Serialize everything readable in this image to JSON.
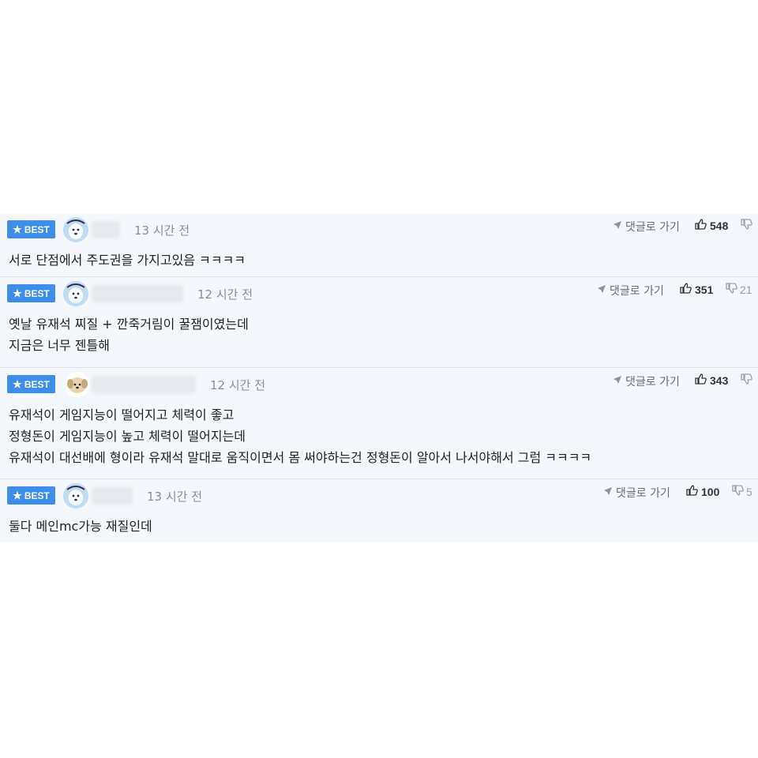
{
  "badge_label": "BEST",
  "reply_label": "댓글로 가기",
  "comments": [
    {
      "time": "13 시간 전",
      "likes": "548",
      "dislikes": "",
      "lines": [
        "서로 단점에서 주도권을 가지고있음 ㅋㅋㅋㅋ"
      ]
    },
    {
      "time": "12 시간 전",
      "likes": "351",
      "dislikes": "21",
      "lines": [
        "옛날 유재석 찌질 + 깐죽거림이 꿀잼이였는데",
        "지금은 너무 젠틀해"
      ]
    },
    {
      "time": "12 시간 전",
      "likes": "343",
      "dislikes": "",
      "lines": [
        "유재석이 게임지능이 떨어지고 체력이 좋고",
        "정형돈이 게임지능이 높고 체력이 떨어지는데",
        "유재석이 대선배에 형이라 유재석 말대로 움직이면서 몸 써야하는건 정형돈이 알아서 나서야해서 그럼 ㅋㅋㅋㅋ"
      ]
    },
    {
      "time": "13 시간 전",
      "likes": "100",
      "dislikes": "5",
      "lines": [
        "둘다 메인mc가능 재질인데"
      ]
    }
  ],
  "icons": {
    "badge": "star-icon",
    "reply": "arrow-icon",
    "like": "thumbs-up-icon",
    "dislike": "thumbs-down-icon"
  },
  "colors": {
    "badge_bg": "#3d8ee8",
    "row_bg": "#f4f7fb"
  }
}
